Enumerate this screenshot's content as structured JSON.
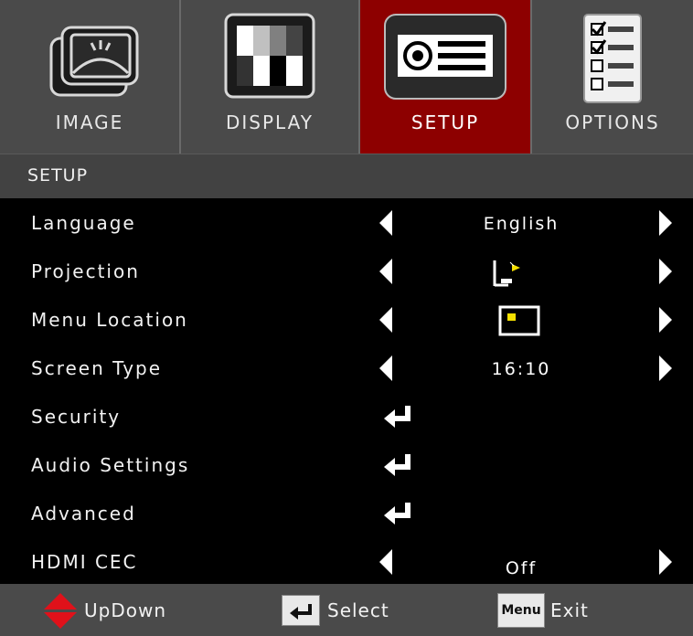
{
  "tabs": [
    {
      "label": "IMAGE",
      "icon": "image-icon",
      "active": false
    },
    {
      "label": "DISPLAY",
      "icon": "display-icon",
      "active": false
    },
    {
      "label": "SETUP",
      "icon": "projector-icon",
      "active": true
    },
    {
      "label": "OPTIONS",
      "icon": "options-checklist-icon",
      "active": false
    }
  ],
  "section_title": "SETUP",
  "rows": [
    {
      "label": "Language",
      "value": "English",
      "control": "arrows"
    },
    {
      "label": "Projection",
      "value": "",
      "value_icon": "projection-mode-icon",
      "control": "arrows"
    },
    {
      "label": "Menu Location",
      "value": "",
      "value_icon": "menu-location-icon",
      "control": "arrows"
    },
    {
      "label": "Screen Type",
      "value": "16:10",
      "control": "arrows"
    },
    {
      "label": "Security",
      "control": "enter"
    },
    {
      "label": "Audio Settings",
      "control": "enter"
    },
    {
      "label": "Advanced",
      "control": "enter"
    },
    {
      "label": "HDMI CEC",
      "value": "Off",
      "control": "arrows"
    }
  ],
  "footer": {
    "updown_label": "UpDown",
    "select_label": "Select",
    "menu_key": "Menu",
    "exit_label": "Exit"
  },
  "colors": {
    "active_tab": "#8d0000",
    "bar_gray": "#4a4a4a",
    "background": "#000000",
    "updown_red": "#e0111a",
    "accent_yellow": "#f5e000"
  }
}
